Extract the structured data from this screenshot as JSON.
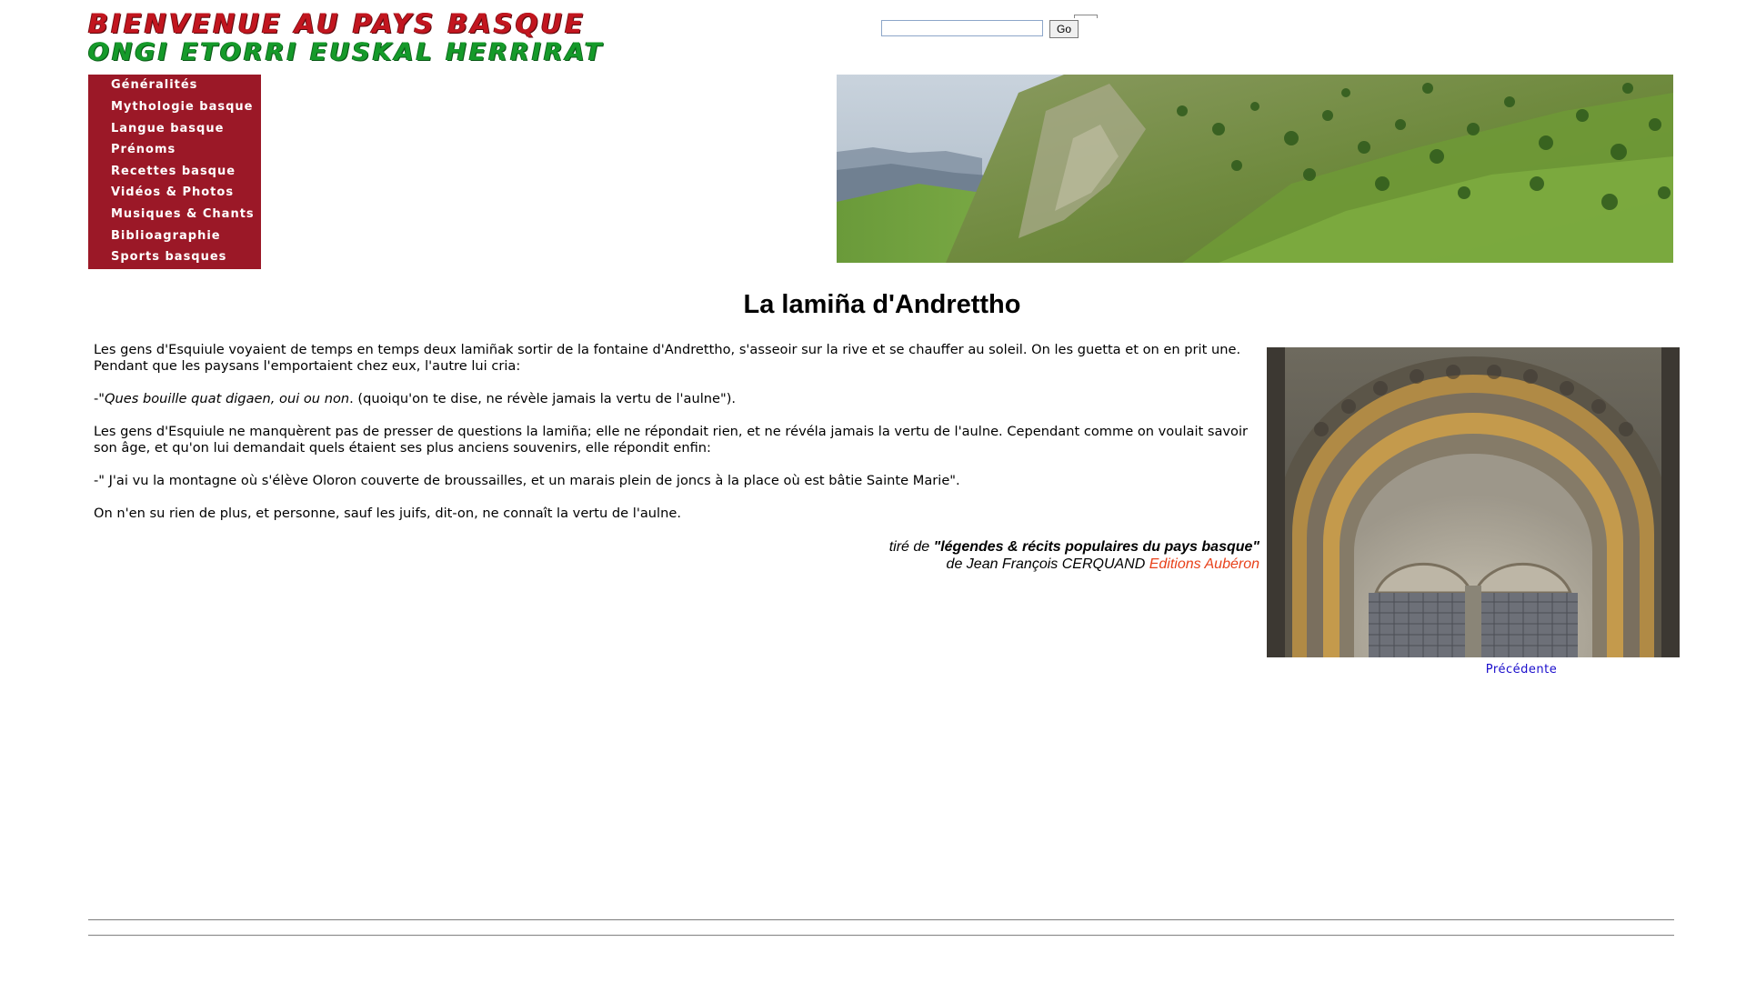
{
  "header": {
    "logo_fr": "Bienvenue au Pays Basque",
    "logo_eu": "Ongi Etorri Euskal Herrirat",
    "colors": {
      "logo_fr": "#c2161f",
      "logo_eu": "#159a2a"
    }
  },
  "search": {
    "placeholder": "",
    "value": "",
    "button_label": "Go"
  },
  "menu": {
    "background": "#9b1827",
    "items": [
      {
        "label": "Généralités"
      },
      {
        "label": "Mythologie basque"
      },
      {
        "label": "Langue basque"
      },
      {
        "label": "Prénoms"
      },
      {
        "label": "Recettes basque"
      },
      {
        "label": "Vidéos & Photos"
      },
      {
        "label": "Musiques & Chants"
      },
      {
        "label": "Biblioagraphie"
      },
      {
        "label": "Sports basques"
      }
    ]
  },
  "banner": {
    "icon": "mountain-landscape-image"
  },
  "article": {
    "title": "La lamiña d'Andrettho",
    "paragraph1": "Les gens d'Esquiule voyaient de temps en temps deux lamiñak sortir de la fontaine d'Andrettho, s'asseoir sur la rive et se chauffer au soleil. On les guetta et on en prit une. Pendant que les paysans l'emportaient chez eux, l'autre lui cria:",
    "quote1_prefix": "-\"",
    "quote1_italic": "Ques bouille quat digaen, oui ou non",
    "quote1_suffix": ". (quoiqu'on te dise, ne révèle jamais la vertu de l'aulne\").",
    "paragraph2": "Les gens d'Esquiule ne manquèrent pas de presser de questions la lamiña; elle ne répondait rien, et ne révéla jamais la vertu de l'aulne. Cependant comme on voulait savoir son âge, et qu'on lui demandait quels étaient ses plus anciens souvenirs, elle répondit enfin:",
    "quote2": "-\" J'ai vu la montagne où s'élève Oloron couverte de broussailles, et un marais plein de joncs à la place où est bâtie Sainte Marie\".",
    "paragraph3": "On n'en su rien de plus, et personne, sauf les juifs, dit-on, ne connaît la vertu de l'aulne."
  },
  "source": {
    "prefix": "tiré de ",
    "book": "\"légendes & récits populaires du pays basque\"",
    "author_line": "de Jean François CERQUAND ",
    "publisher": "Editions Aubéron",
    "publisher_color": "#e8411a"
  },
  "photo": {
    "icon": "romanesque-portal-photo"
  },
  "navigation": {
    "previous_label": "Précédente",
    "link_color": "#1a0dcc"
  }
}
